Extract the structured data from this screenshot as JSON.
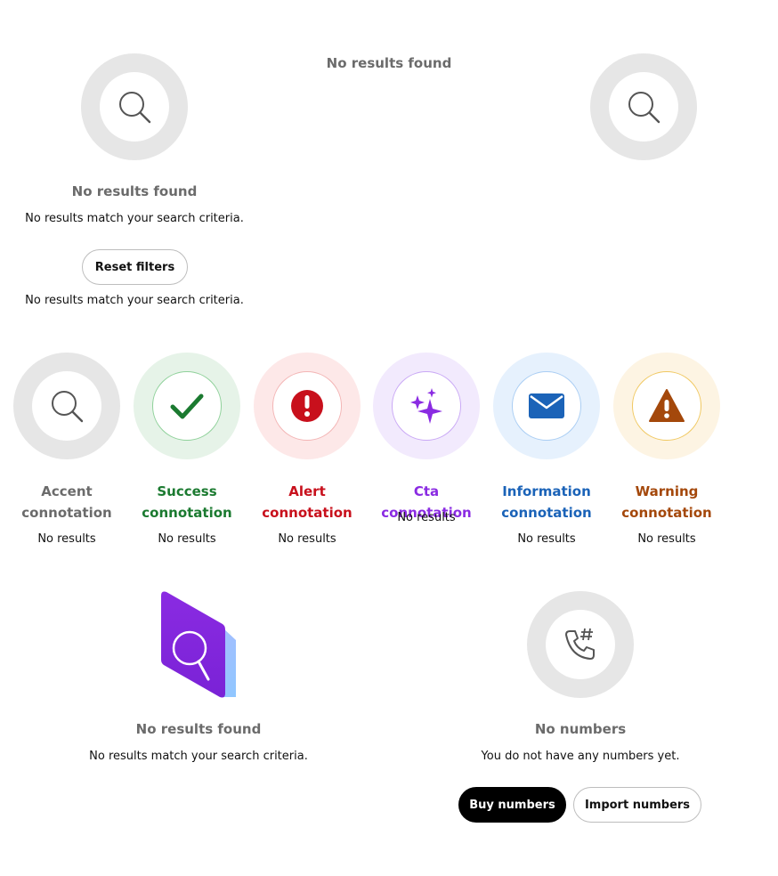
{
  "section1": {
    "left": {
      "title": "No results found",
      "description": "No results match your search criteria.",
      "reset_label": "Reset filters",
      "footer_description": "No results match your search criteria."
    },
    "center": {
      "title": "No results found"
    }
  },
  "connotations": [
    {
      "title": "Accent connotation",
      "subtitle": "No results",
      "color": "#6b6b6b",
      "ring": "#e6e6e6",
      "icon": "search-icon"
    },
    {
      "title": "Success connotation",
      "subtitle": "No results",
      "color": "#1b7a30",
      "ring": "#e6f3e8",
      "icon": "checkmark-icon"
    },
    {
      "title": "Alert connotation",
      "subtitle": "No results",
      "color": "#c8101c",
      "ring": "#fde8e8",
      "icon": "alert-icon"
    },
    {
      "title": "Cta connotation",
      "subtitle": "No results",
      "color": "#8a2be2",
      "ring": "#f2eafd",
      "icon": "sparkles-icon"
    },
    {
      "title": "Information connotation",
      "subtitle": "No results",
      "color": "#1b63b8",
      "ring": "#e6f1fd",
      "icon": "envelope-icon"
    },
    {
      "title": "Warning connotation",
      "subtitle": "No results",
      "color": "#a4480b",
      "ring": "#fdf4e3",
      "icon": "warning-icon"
    }
  ],
  "section3": {
    "search": {
      "title": "No results found",
      "description": "No results match your search criteria."
    },
    "numbers": {
      "title": "No numbers",
      "description": "You do not have any numbers yet.",
      "buy_label": "Buy numbers",
      "import_label": "Import numbers"
    }
  }
}
